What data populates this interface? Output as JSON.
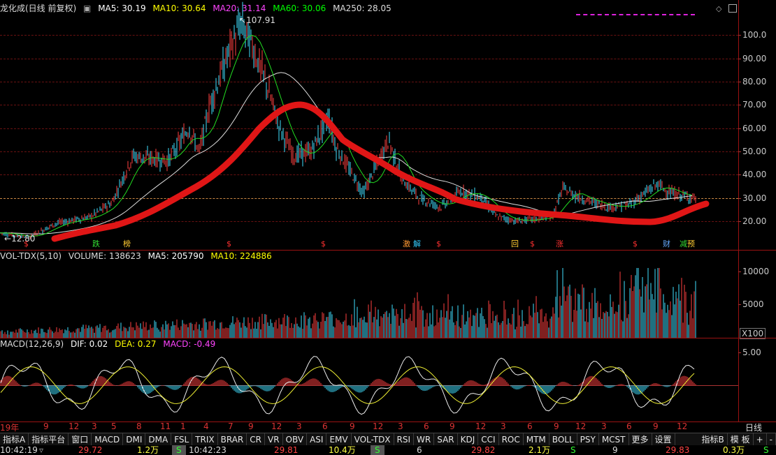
{
  "header": {
    "title": "龙化成(日线 前复权)",
    "ma5": "MA5: 30.19",
    "ma10": "MA10: 30.64",
    "ma20": "MA20: 31.14",
    "ma60": "MA60: 30.06",
    "ma250": "MA250: 28.05",
    "colors": {
      "ma5": "#ffffff",
      "ma10": "#ffff00",
      "ma20": "#ff44ff",
      "ma60": "#00ff00",
      "ma250": "#dddddd"
    }
  },
  "price_scale": [
    "100.0",
    "90.00",
    "80.00",
    "70.00",
    "60.00",
    "50.00",
    "40.00",
    "30.00",
    "20.00"
  ],
  "price_annotations": {
    "high": "107.91",
    "low": "12.80"
  },
  "events": [
    {
      "label": "$",
      "color": "#ff3030"
    },
    {
      "label": "跌",
      "color": "#33dd33"
    },
    {
      "label": "榜",
      "color": "#ffcc33"
    },
    {
      "label": "$",
      "color": "#ff3030"
    },
    {
      "label": "$",
      "color": "#ff3030"
    },
    {
      "label": "激",
      "color": "#ff9933"
    },
    {
      "label": "解",
      "color": "#33ccff"
    },
    {
      "label": "$",
      "color": "#ff3030"
    },
    {
      "label": "回",
      "color": "#ffcc33"
    },
    {
      "label": "$",
      "color": "#ff3030"
    },
    {
      "label": "涨",
      "color": "#ff3030"
    },
    {
      "label": "$",
      "color": "#ff3030"
    },
    {
      "label": "财",
      "color": "#66aaff"
    },
    {
      "label": "减",
      "color": "#33dd33"
    },
    {
      "label": "预",
      "color": "#ffcc33"
    }
  ],
  "volume": {
    "title": "VOL-TDX(5,10)",
    "volume": "VOLUME: 138623",
    "ma5": "MA5: 205790",
    "ma10": "MA10: 224886",
    "scale": [
      "10000",
      "5000"
    ],
    "unit": "X100"
  },
  "macd": {
    "title": "MACD(12,26,9)",
    "dif": "DIF: 0.02",
    "dea": "DEA: 0.27",
    "macd": "MACD: -0.49",
    "scale": [
      "5.00"
    ]
  },
  "time_axis": [
    "19年",
    "9",
    "12",
    "3",
    "5",
    "8",
    "11",
    "1",
    "4",
    "7",
    "9",
    "12",
    "3",
    "6",
    "9",
    "12",
    "3",
    "6",
    "9",
    "12",
    "3",
    "6",
    "9",
    "12",
    "3",
    "6",
    "9",
    "12"
  ],
  "period_label": "日线",
  "toolbar": [
    "指标A",
    "指标平台",
    "窗口",
    "MACD",
    "DMI",
    "DMA",
    "FSL",
    "TRIX",
    "BRAR",
    "CR",
    "VR",
    "OBV",
    "ASI",
    "EMV",
    "VOL-TDX",
    "RSI",
    "WR",
    "SAR",
    "KDJ",
    "CCI",
    "ROC",
    "MTM",
    "BOLL",
    "PSY",
    "MCST",
    "更多",
    "设置"
  ],
  "toolbar_right": [
    "指标B",
    "模 板",
    "+",
    "-"
  ],
  "status": {
    "t1": "10:42:19",
    "v1": "29.72",
    "q1": "1.2万",
    "s1": "S",
    "t2": "10:42:23",
    "v2": "29.81",
    "q2": "10.4万",
    "s2": "S",
    "n3": "6",
    "v3": "29.82",
    "q3": "2.1万",
    "s3": "S",
    "n4": "9",
    "v4": "29.83",
    "q4": "0.3万",
    "s4": "S"
  }
}
